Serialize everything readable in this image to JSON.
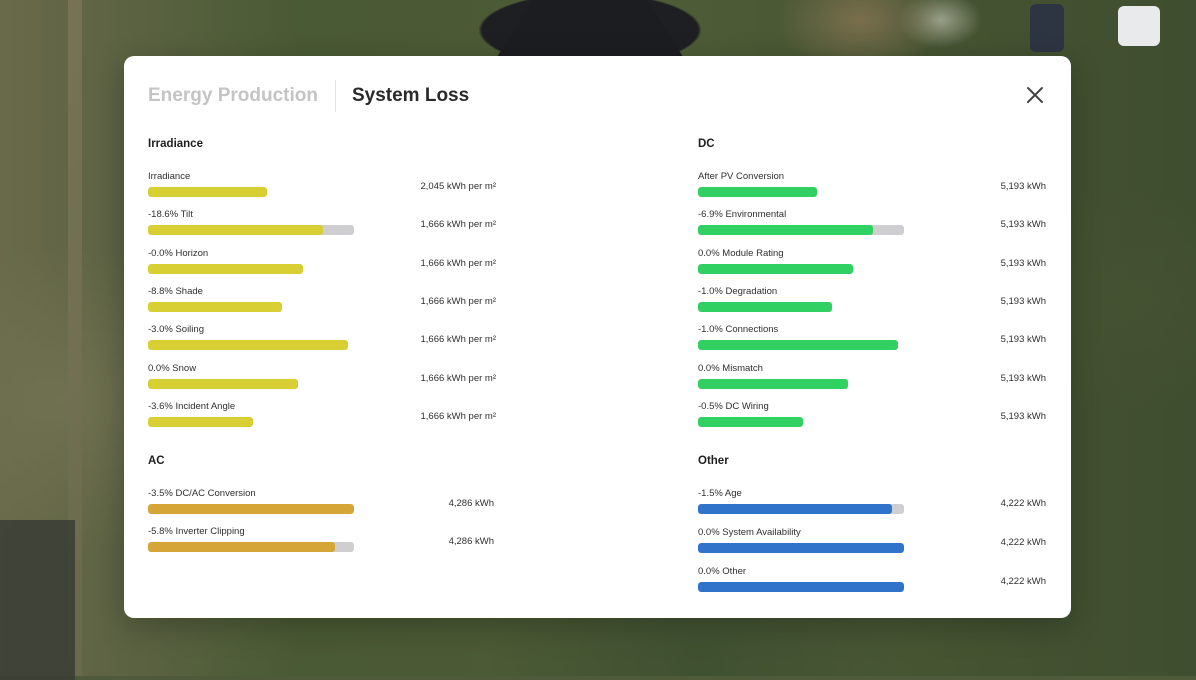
{
  "colors": {
    "irradiance": "#d7cf33",
    "dc": "#31d063",
    "ac": "#d5a637",
    "other": "#2f73cb",
    "track": "#cfcfd1"
  },
  "tabs": [
    {
      "label": "Energy Production",
      "active": false
    },
    {
      "label": "System Loss",
      "active": true
    }
  ],
  "close_icon": "close-icon",
  "sections": [
    {
      "key": "irradiance",
      "title": "Irradiance",
      "color": "#d7cf33",
      "rows": [
        {
          "label": "Irradiance",
          "value": "2,045 kWh per m²",
          "fill": 0.58,
          "track": false
        },
        {
          "label": "-18.6% Tilt",
          "value": "1,666 kWh per m²",
          "fill": 0.85,
          "track": true
        },
        {
          "label": "-0.0% Horizon",
          "value": "1,666 kWh per m²",
          "fill": 0.75,
          "track": false
        },
        {
          "label": "-8.8% Shade",
          "value": "1,666 kWh per m²",
          "fill": 0.65,
          "track": false
        },
        {
          "label": "-3.0% Soiling",
          "value": "1,666 kWh per m²",
          "fill": 0.97,
          "track": false
        },
        {
          "label": "0.0% Snow",
          "value": "1,666 kWh per m²",
          "fill": 0.73,
          "track": false
        },
        {
          "label": "-3.6% Incident Angle",
          "value": "1,666 kWh per m²",
          "fill": 0.51,
          "track": false
        }
      ]
    },
    {
      "key": "dc",
      "title": "DC",
      "color": "#31d063",
      "rows": [
        {
          "label": "After PV Conversion",
          "value": "5,193 kWh",
          "fill": 0.58,
          "track": false
        },
        {
          "label": "-6.9% Environmental",
          "value": "5,193 kWh",
          "fill": 0.85,
          "track": true
        },
        {
          "label": "0.0% Module Rating",
          "value": "5,193 kWh",
          "fill": 0.75,
          "track": false
        },
        {
          "label": "-1.0% Degradation",
          "value": "5,193 kWh",
          "fill": 0.65,
          "track": false
        },
        {
          "label": "-1.0% Connections",
          "value": "5,193 kWh",
          "fill": 0.97,
          "track": false
        },
        {
          "label": "0.0% Mismatch",
          "value": "5,193 kWh",
          "fill": 0.73,
          "track": false
        },
        {
          "label": "-0.5% DC Wiring",
          "value": "5,193 kWh",
          "fill": 0.51,
          "track": false
        }
      ]
    },
    {
      "key": "ac",
      "title": "AC",
      "color": "#d5a637",
      "rows": [
        {
          "label": "-3.5% DC/AC Conversion",
          "value": "4,286 kWh",
          "fill": 1.0,
          "track": false
        },
        {
          "label": "-5.8% Inverter Clipping",
          "value": "4,286 kWh",
          "fill": 0.91,
          "track": true
        }
      ]
    },
    {
      "key": "other",
      "title": "Other",
      "color": "#2f73cb",
      "rows": [
        {
          "label": "-1.5% Age",
          "value": "4,222 kWh",
          "fill": 0.94,
          "track": true
        },
        {
          "label": "0.0% System Availability",
          "value": "4,222 kWh",
          "fill": 1.0,
          "track": false
        },
        {
          "label": "0.0% Other",
          "value": "4,222 kWh",
          "fill": 1.0,
          "track": false
        }
      ]
    }
  ]
}
